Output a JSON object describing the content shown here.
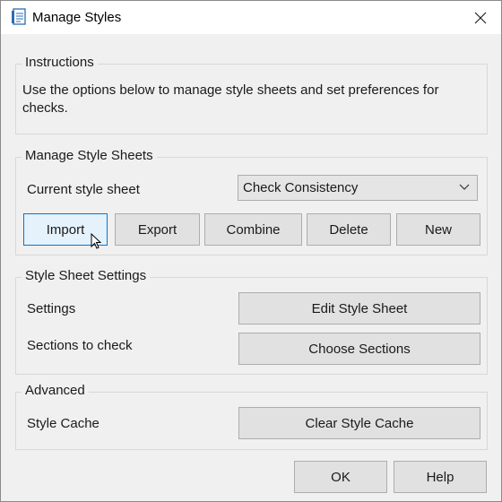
{
  "window": {
    "title": "Manage Styles"
  },
  "instructions": {
    "legend": "Instructions",
    "text": "Use the options below to manage style sheets and set preferences for checks."
  },
  "manage": {
    "legend": "Manage Style Sheets",
    "current_label": "Current style sheet",
    "current_value": "Check Consistency",
    "buttons": {
      "import": "Import",
      "export": "Export",
      "combine": "Combine",
      "delete": "Delete",
      "new": "New"
    }
  },
  "settings": {
    "legend": "Style Sheet Settings",
    "settings_label": "Settings",
    "edit_button": "Edit Style Sheet",
    "sections_label": "Sections to check",
    "choose_button": "Choose Sections"
  },
  "advanced": {
    "legend": "Advanced",
    "cache_label": "Style Cache",
    "clear_button": "Clear Style Cache"
  },
  "footer": {
    "ok": "OK",
    "help": "Help"
  },
  "icons": {
    "app": "document-style-icon",
    "close": "close-icon",
    "dropdown": "chevron-down-icon",
    "cursor": "mouse-pointer-icon"
  }
}
